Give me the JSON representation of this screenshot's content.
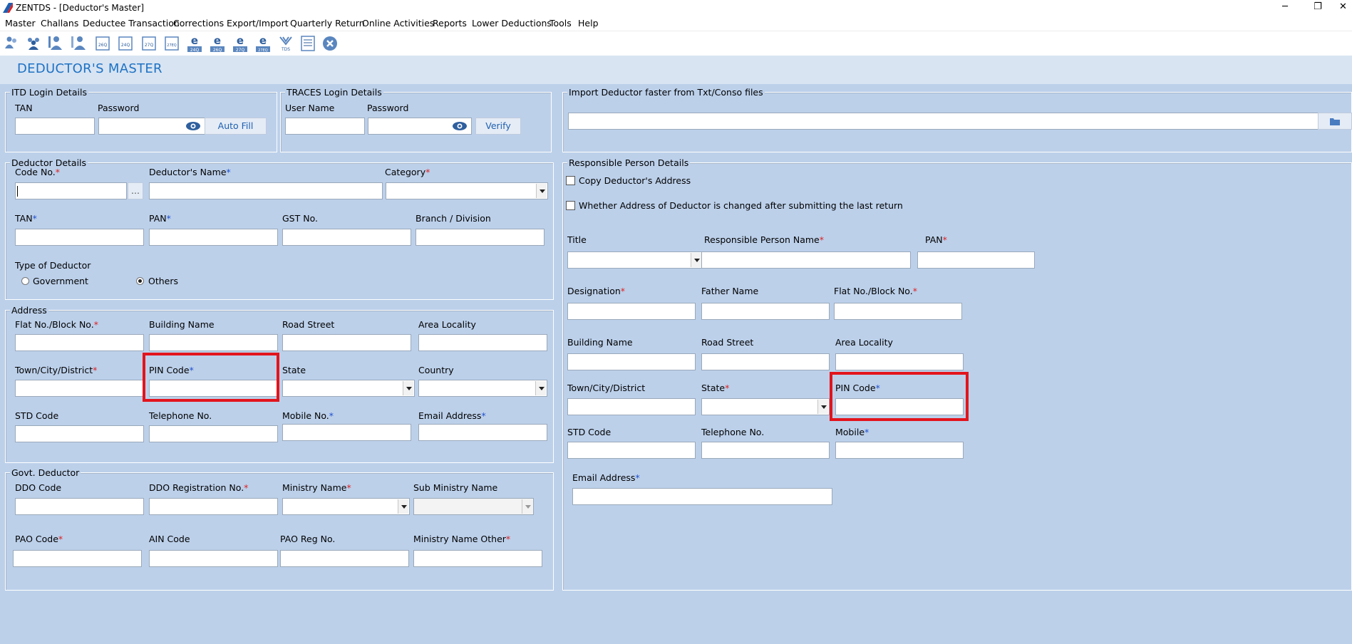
{
  "window": {
    "title": "ZENTDS - [Deductor's Master]",
    "minimize": "─",
    "restore": "❐",
    "close": "✕"
  },
  "menu": [
    "Master",
    "Challans",
    "Deductee Transaction",
    "Corrections",
    "Export/Import",
    "Quarterly Return",
    "Online Activities",
    "Reports",
    "Lower Deductions",
    "Tools",
    "Help"
  ],
  "toolbar": {
    "icons": [
      "users-icon",
      "users-group-icon",
      "person-add-icon",
      "person-edit-icon",
      "form-26q-icon",
      "form-24q-icon",
      "form-27q-icon",
      "form-27eq-icon",
      "e-24q-icon",
      "e-26q-icon",
      "e-27q-icon",
      "e-27eq-icon",
      "tds-icon",
      "document-list-icon",
      "close-circle-icon"
    ],
    "labels": [
      "26Q",
      "24Q",
      "27Q",
      "27EQ",
      "24Q",
      "26Q",
      "27Q",
      "27EQ",
      "TDS"
    ]
  },
  "header": {
    "title": "DEDUCTOR'S MASTER"
  },
  "itd": {
    "legend": "ITD Login Details",
    "tan": "TAN",
    "password": "Password",
    "autofill": "Auto Fill"
  },
  "traces": {
    "legend": "TRACES Login Details",
    "username": "User Name",
    "password": "Password",
    "verify": "Verify"
  },
  "import": {
    "legend": "Import Deductor faster from Txt/Conso files"
  },
  "deductor": {
    "legend": "Deductor Details",
    "code": "Code No.",
    "name": "Deductor's Name",
    "category": "Category",
    "tan": "TAN",
    "pan": "PAN",
    "gst": "GST No.",
    "branch": "Branch / Division",
    "type": "Type of Deductor",
    "gov": "Government",
    "others": "Others",
    "ellipsis": "..."
  },
  "address": {
    "legend": "Address",
    "flat": "Flat No./Block No.",
    "building": "Building Name",
    "road": "Road Street",
    "area": "Area Locality",
    "town": "Town/City/District",
    "pin": "PIN Code",
    "state": "State",
    "country": "Country",
    "std": "STD Code",
    "tel": "Telephone No.",
    "mobile": "Mobile No.",
    "email": "Email Address"
  },
  "govt": {
    "legend": "Govt. Deductor",
    "ddo": "DDO Code",
    "ddoreg": "DDO Registration No.",
    "ministry": "Ministry Name",
    "subministry": "Sub Ministry Name",
    "pao": "PAO Code",
    "ain": "AIN Code",
    "paoreg": "PAO Reg No.",
    "ministryother": "Ministry Name Other"
  },
  "resp": {
    "legend": "Responsible Person Details",
    "copy": "Copy Deductor's Address",
    "changed": "Whether Address of Deductor is changed after submitting the last return",
    "title": "Title",
    "name": "Responsible Person Name",
    "pan": "PAN",
    "designation": "Designation",
    "father": "Father Name",
    "flat": "Flat No./Block No.",
    "building": "Building Name",
    "road": "Road Street",
    "area": "Area Locality",
    "town": "Town/City/District",
    "state": "State",
    "pin": "PIN Code",
    "std": "STD Code",
    "tel": "Telephone No.",
    "mobile": "Mobile",
    "email": "Email Address"
  },
  "required_marker": "*",
  "colors": {
    "background": "#bcd0ea",
    "header": "#d8e4f2",
    "title": "#1e72c4",
    "highlight": "#e3141c",
    "required_red": "#e02020",
    "required_blue": "#1e4fd0"
  }
}
